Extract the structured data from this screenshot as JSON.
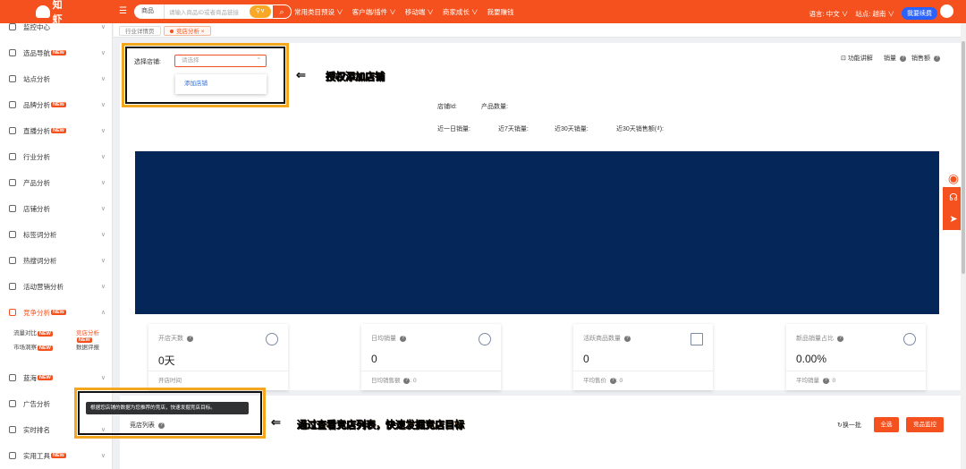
{
  "header": {
    "logo_text": "知虾",
    "search_scope": "商品",
    "search_placeholder": "请输入商品ID或者商品链接",
    "image_search_label": "",
    "nav": [
      "常用类目预设 ∨",
      "客户端/插件 ∨",
      "移动端 ∨",
      "商家成长 ∨",
      "我要赚钱"
    ],
    "language": "语言: 中文 ∨",
    "site": "站点: 越南 ∨",
    "renew": "我要续费"
  },
  "sidebar": {
    "items": [
      {
        "label": "监控中心",
        "new": false
      },
      {
        "label": "选品导航",
        "new": true
      },
      {
        "label": "站点分析",
        "new": false
      },
      {
        "label": "品牌分析",
        "new": true
      },
      {
        "label": "直播分析",
        "new": true
      },
      {
        "label": "行业分析",
        "new": false
      },
      {
        "label": "产品分析",
        "new": false
      },
      {
        "label": "店铺分析",
        "new": false
      },
      {
        "label": "标签词分析",
        "new": false
      },
      {
        "label": "热搜词分析",
        "new": false
      },
      {
        "label": "活动营销分析",
        "new": false
      },
      {
        "label": "竞争分析",
        "new": true
      },
      {
        "label": "蓝海",
        "new": true
      },
      {
        "label": "广告分析",
        "new": false
      },
      {
        "label": "实时排名",
        "new": false
      },
      {
        "label": "实用工具",
        "new": true
      }
    ],
    "sub_items": [
      {
        "label": "流量对比",
        "new": true
      },
      {
        "label": "竞店分析",
        "new": true
      },
      {
        "label": "市场洞察",
        "new": true
      },
      {
        "label": "数据评报",
        "new": false
      }
    ],
    "new_badge": "NEW"
  },
  "tabs": [
    "行业详情页",
    "竞店分析"
  ],
  "panel": {
    "store_select_label": "选择店铺:",
    "store_select_placeholder": "请选择",
    "dropdown_option": "添加店铺",
    "tools": [
      "功能讲解",
      "销量",
      "销售额"
    ],
    "store_id_label": "店铺Id:",
    "product_count_label": "产品数量:",
    "metrics": [
      "近一日销量:",
      "近7天销量:",
      "近30天销量:",
      "近30天销售额(₫):"
    ]
  },
  "annotations": {
    "top": "授权添加店铺",
    "bottom": "通过查看竞店列表，快速发掘竞店目标"
  },
  "stats": [
    {
      "title": "开店天数",
      "value": "0天",
      "sub": "开店时间",
      "sub_value": ""
    },
    {
      "title": "日均销量",
      "value": "0",
      "sub": "日均销售额",
      "sub_value": "0"
    },
    {
      "title": "活跃商品数量",
      "value": "0",
      "sub": "平均售价",
      "sub_value": "0"
    },
    {
      "title": "新品销量占比",
      "value": "0.00%",
      "sub": "平均销量",
      "sub_value": "0"
    }
  ],
  "competitor": {
    "tooltip": "根据您店铺的数据为您推荐的竞店，快速发掘竞店目标。",
    "title": "竞店列表",
    "refresh": "换一批",
    "all_button": "全选",
    "monitor_button": "竞品监控"
  }
}
